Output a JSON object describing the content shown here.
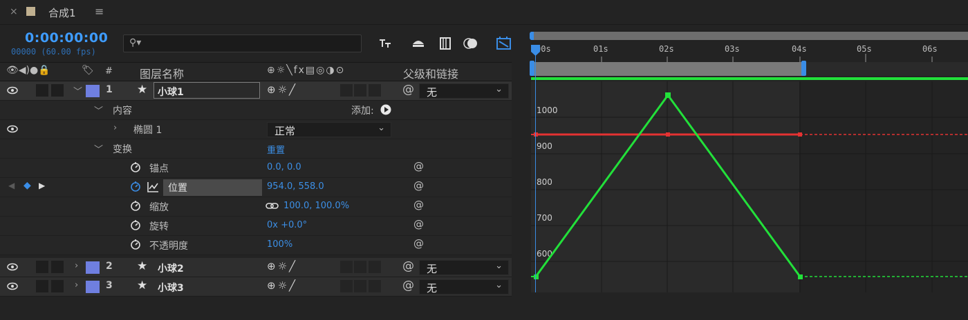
{
  "tab": {
    "close": "×",
    "title": "合成1",
    "menu": "≡"
  },
  "time": {
    "timecode": "0:00:00:00",
    "fps": "00000 (60.00 fps)"
  },
  "search": {
    "placeholder": ""
  },
  "columns": {
    "number": "#",
    "layer_name": "图层名称",
    "parent": "父级和链接"
  },
  "layers": [
    {
      "index": "1",
      "name": "小球1",
      "parent": "无",
      "color": "#6f7fe0"
    },
    {
      "index": "2",
      "name": "小球2",
      "parent": "无",
      "color": "#6f7fe0"
    },
    {
      "index": "3",
      "name": "小球3",
      "parent": "无",
      "color": "#6f7fe0"
    }
  ],
  "contents": {
    "label": "内容",
    "add_label": "添加:",
    "ellipse": "椭圆 1",
    "blend_mode": "正常"
  },
  "transform": {
    "label": "变换",
    "reset": "重置",
    "props": [
      {
        "name": "锚点",
        "value": "0.0, 0.0"
      },
      {
        "name": "位置",
        "value": "954.0, 558.0"
      },
      {
        "name": "缩放",
        "value": "100.0, 100.0%"
      },
      {
        "name": "旋转",
        "value": "0x +0.0°"
      },
      {
        "name": "不透明度",
        "value": "100%"
      }
    ]
  },
  "ruler": {
    "ticks": [
      "00s",
      "01s",
      "02s",
      "03s",
      "04s",
      "05s",
      "06s"
    ]
  },
  "graph": {
    "y_labels": [
      "1000",
      "900",
      "800",
      "700",
      "600"
    ],
    "colors": {
      "green": "#22e03a",
      "red": "#e53232",
      "playhead": "#3a8de6"
    }
  }
}
